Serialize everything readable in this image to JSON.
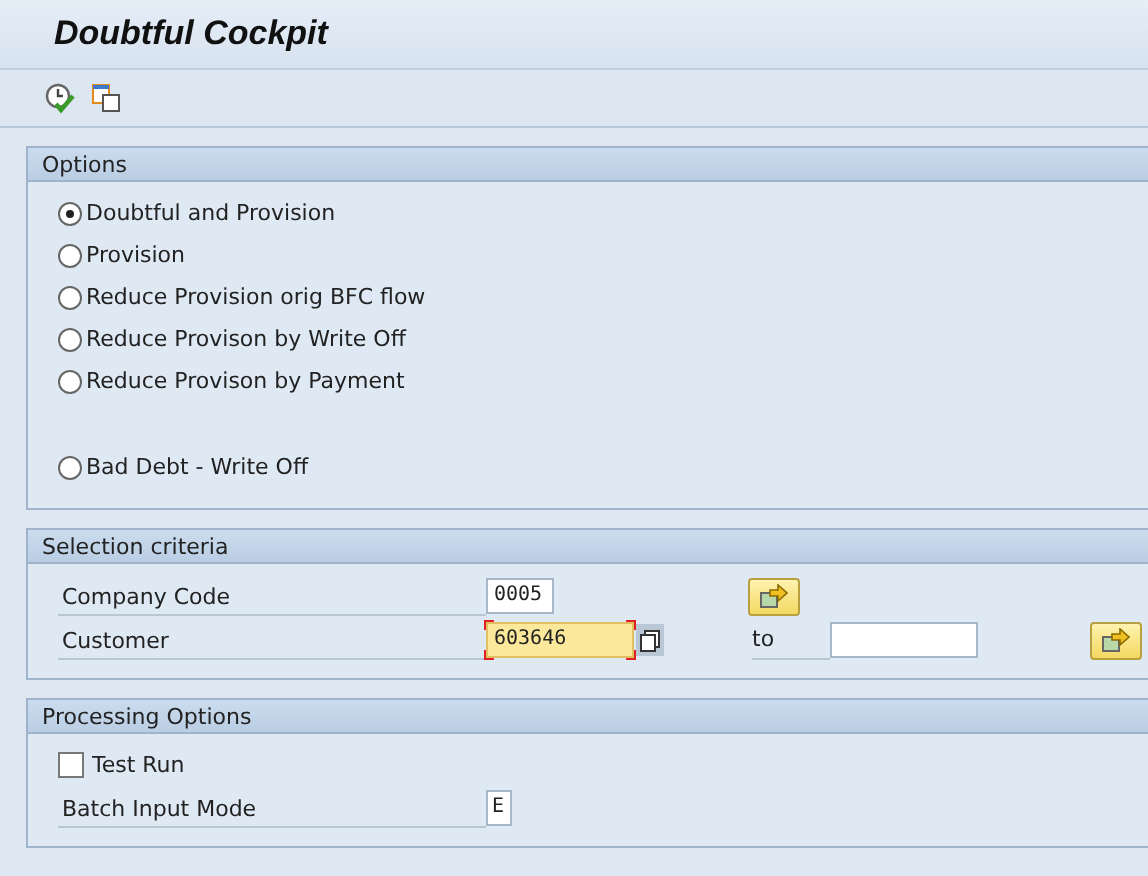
{
  "window": {
    "title": "Doubtful Cockpit"
  },
  "options": {
    "title": "Options",
    "radio_groups": [
      [
        {
          "label": "Doubtful and Provision",
          "selected": true
        },
        {
          "label": "Provision",
          "selected": false
        },
        {
          "label": "Reduce Provision orig BFC flow",
          "selected": false
        },
        {
          "label": "Reduce Provison by Write Off",
          "selected": false
        },
        {
          "label": "Reduce Provison by Payment",
          "selected": false
        }
      ],
      [
        {
          "label": "Bad Debt - Write Off",
          "selected": false
        }
      ]
    ]
  },
  "selection_criteria": {
    "title": "Selection criteria",
    "rows": [
      {
        "label": "Company Code",
        "value": "0005",
        "focused": false,
        "range": false
      },
      {
        "label": "Customer",
        "value": "603646",
        "focused": true,
        "range": true,
        "to_label": "to"
      }
    ]
  },
  "processing_options": {
    "title": "Processing Options",
    "items": [
      {
        "kind": "checkbox",
        "label": "Test Run",
        "checked": false
      },
      {
        "kind": "field",
        "label": "Batch Input Mode",
        "value": "E"
      }
    ]
  }
}
